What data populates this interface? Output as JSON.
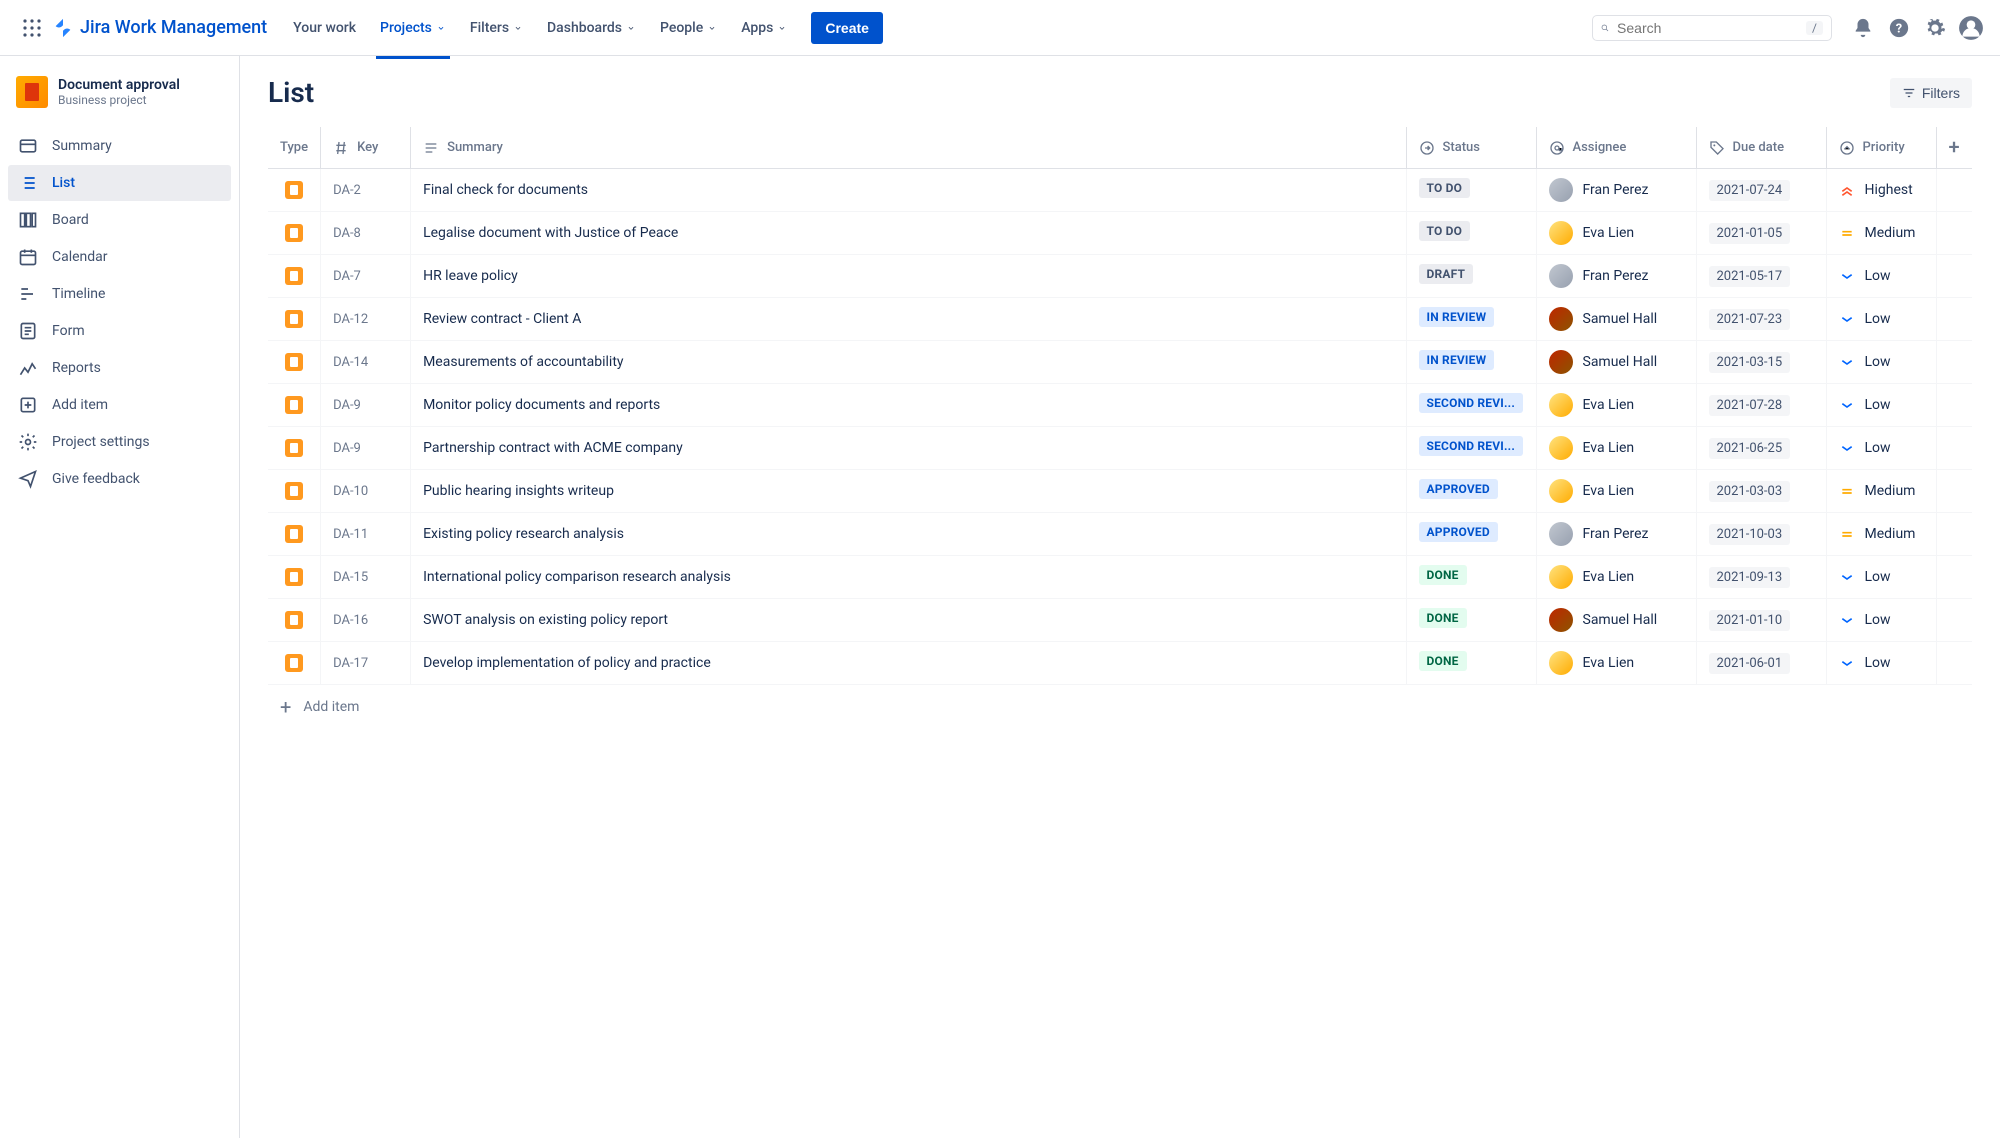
{
  "topnav": {
    "logo": "Jira Work Management",
    "items": [
      "Your work",
      "Projects",
      "Filters",
      "Dashboards",
      "People",
      "Apps"
    ],
    "active_index": 1,
    "create": "Create",
    "search_placeholder": "Search",
    "search_kbd": "/"
  },
  "sidebar": {
    "project_name": "Document approval",
    "project_type": "Business project",
    "items": [
      {
        "label": "Summary",
        "icon": "card"
      },
      {
        "label": "List",
        "icon": "list"
      },
      {
        "label": "Board",
        "icon": "board"
      },
      {
        "label": "Calendar",
        "icon": "calendar"
      },
      {
        "label": "Timeline",
        "icon": "timeline"
      },
      {
        "label": "Form",
        "icon": "form"
      },
      {
        "label": "Reports",
        "icon": "reports"
      },
      {
        "label": "Add item",
        "icon": "add"
      },
      {
        "label": "Project settings",
        "icon": "settings"
      },
      {
        "label": "Give feedback",
        "icon": "feedback"
      }
    ],
    "active_index": 1
  },
  "page": {
    "title": "List",
    "filters": "Filters",
    "add_item": "Add item"
  },
  "columns": {
    "type": "Type",
    "key": "Key",
    "summary": "Summary",
    "status": "Status",
    "assignee": "Assignee",
    "due_date": "Due date",
    "priority": "Priority"
  },
  "rows": [
    {
      "key": "DA-2",
      "summary": "Final check for documents",
      "status": "TO DO",
      "status_class": "todo",
      "assignee": "Fran Perez",
      "avatar": "fp",
      "due": "2021-07-24",
      "priority": "Highest",
      "prio": "highest"
    },
    {
      "key": "DA-8",
      "summary": "Legalise document with Justice of Peace",
      "status": "TO DO",
      "status_class": "todo",
      "assignee": "Eva Lien",
      "avatar": "el",
      "due": "2021-01-05",
      "priority": "Medium",
      "prio": "medium"
    },
    {
      "key": "DA-7",
      "summary": "HR leave policy",
      "status": "DRAFT",
      "status_class": "draft",
      "assignee": "Fran Perez",
      "avatar": "fp",
      "due": "2021-05-17",
      "priority": "Low",
      "prio": "low"
    },
    {
      "key": "DA-12",
      "summary": "Review contract - Client A",
      "status": "IN REVIEW",
      "status_class": "review",
      "assignee": "Samuel Hall",
      "avatar": "sh",
      "due": "2021-07-23",
      "priority": "Low",
      "prio": "low"
    },
    {
      "key": "DA-14",
      "summary": "Measurements of accountability",
      "status": "IN REVIEW",
      "status_class": "review",
      "assignee": "Samuel Hall",
      "avatar": "sh",
      "due": "2021-03-15",
      "priority": "Low",
      "prio": "low"
    },
    {
      "key": "DA-9",
      "summary": "Monitor policy documents and reports",
      "status": "SECOND REVI...",
      "status_class": "review",
      "assignee": "Eva Lien",
      "avatar": "el",
      "due": "2021-07-28",
      "priority": "Low",
      "prio": "low"
    },
    {
      "key": "DA-9",
      "summary": "Partnership contract with ACME company",
      "status": "SECOND REVI...",
      "status_class": "review",
      "assignee": "Eva Lien",
      "avatar": "el",
      "due": "2021-06-25",
      "priority": "Low",
      "prio": "low"
    },
    {
      "key": "DA-10",
      "summary": "Public hearing insights writeup",
      "status": "APPROVED",
      "status_class": "review",
      "assignee": "Eva Lien",
      "avatar": "el",
      "due": "2021-03-03",
      "priority": "Medium",
      "prio": "medium"
    },
    {
      "key": "DA-11",
      "summary": "Existing policy research analysis",
      "status": "APPROVED",
      "status_class": "review",
      "assignee": "Fran Perez",
      "avatar": "fp",
      "due": "2021-10-03",
      "priority": "Medium",
      "prio": "medium"
    },
    {
      "key": "DA-15",
      "summary": "International policy comparison research analysis",
      "status": "DONE",
      "status_class": "done",
      "assignee": "Eva Lien",
      "avatar": "el",
      "due": "2021-09-13",
      "priority": "Low",
      "prio": "low"
    },
    {
      "key": "DA-16",
      "summary": "SWOT analysis on existing policy report",
      "status": "DONE",
      "status_class": "done",
      "assignee": "Samuel Hall",
      "avatar": "sh",
      "due": "2021-01-10",
      "priority": "Low",
      "prio": "low"
    },
    {
      "key": "DA-17",
      "summary": "Develop implementation of policy and practice",
      "status": "DONE",
      "status_class": "done",
      "assignee": "Eva Lien",
      "avatar": "el",
      "due": "2021-06-01",
      "priority": "Low",
      "prio": "low"
    }
  ]
}
